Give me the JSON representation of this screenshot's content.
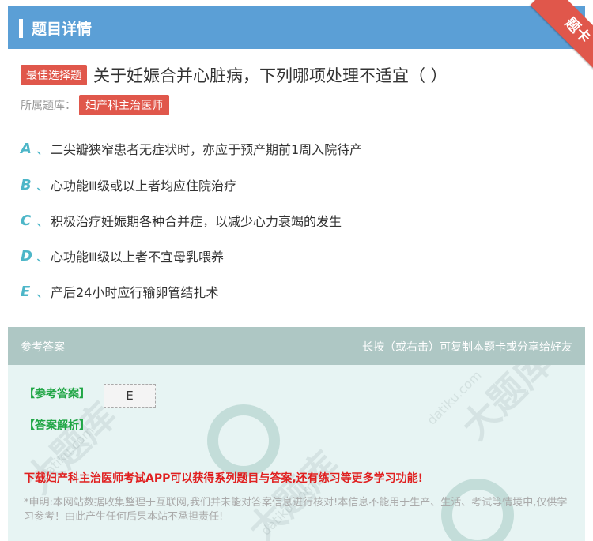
{
  "header": {
    "title": "题目详情",
    "corner_label": "题卡"
  },
  "question": {
    "tag": "最佳选择题",
    "text": "关于妊娠合并心脏病，下列哪项处理不适宜（ ）",
    "category_label": "所属题库：",
    "category": "妇产科主治医师"
  },
  "options": [
    {
      "letter": "A",
      "sep": "、",
      "text": "二尖瓣狭窄患者无症状时，亦应于预产期前1周入院待产"
    },
    {
      "letter": "B",
      "sep": "、",
      "text": "心功能Ⅲ级或以上者均应住院治疗"
    },
    {
      "letter": "C",
      "sep": "、",
      "text": "积极治疗妊娠期各种合并症，以减少心力衰竭的发生"
    },
    {
      "letter": "D",
      "sep": "、",
      "text": "心功能Ⅲ级以上者不宜母乳喂养"
    },
    {
      "letter": "E",
      "sep": "、",
      "text": "产后24小时应行输卵管结扎术"
    }
  ],
  "answer": {
    "header_left": "参考答案",
    "header_right": "长按（或右击）可复制本题卡或分享给好友",
    "answer_label": "【参考答案】",
    "answer_value": "E",
    "analysis_label": "【答案解析】",
    "promo": "下载妇产科主治医师考试APP可以获得系列题目与答案,还有练习等更多学习功能!",
    "disclaimer": "*申明:本网站数据收集整理于互联网,我们并未能对答案信息进行核对!本信息不能用于生产、生活、考试等情境中,仅供学习参考！由此产生任何后果本站不承担责任!"
  },
  "watermark": {
    "main": "大题库",
    "domain": "datiku.com"
  },
  "colors": {
    "header_bg": "#5b9fd6",
    "tag_red": "#e0574b",
    "option_letter": "#4db6c8",
    "answer_green": "#20a645",
    "promo_red": "#e02020"
  }
}
